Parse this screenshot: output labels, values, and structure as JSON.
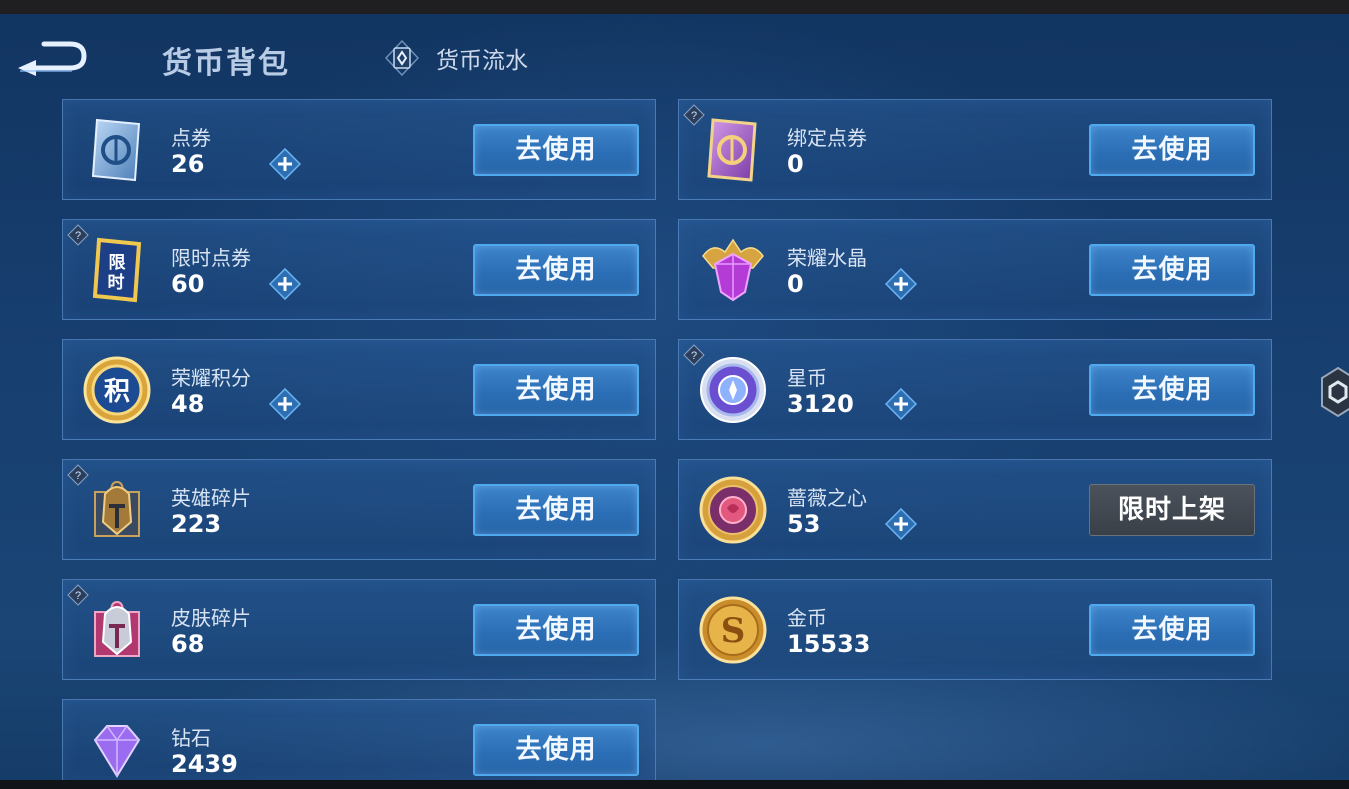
{
  "header": {
    "title": "货币背包",
    "flow_label": "货币流水"
  },
  "currencies": [
    {
      "name": "点券",
      "amount": "26",
      "button": "去使用"
    },
    {
      "name": "绑定点券",
      "amount": "0",
      "button": "去使用"
    },
    {
      "name": "限时点券",
      "amount": "60",
      "button": "去使用",
      "icon_text": "限时"
    },
    {
      "name": "荣耀水晶",
      "amount": "0",
      "button": "去使用"
    },
    {
      "name": "荣耀积分",
      "amount": "48",
      "button": "去使用",
      "icon_text": "积"
    },
    {
      "name": "星币",
      "amount": "3120",
      "button": "去使用"
    },
    {
      "name": "英雄碎片",
      "amount": "223",
      "button": "去使用"
    },
    {
      "name": "蔷薇之心",
      "amount": "53",
      "button": "限时上架"
    },
    {
      "name": "皮肤碎片",
      "amount": "68",
      "button": "去使用"
    },
    {
      "name": "金币",
      "amount": "15533",
      "button": "去使用",
      "icon_text": "S"
    },
    {
      "name": "钻石",
      "amount": "2439",
      "button": "去使用"
    }
  ],
  "icons": {
    "back": "back-arrow-icon",
    "flow": "coin-card-icon",
    "plus": "plus-icon",
    "help": "question-icon",
    "side": "hexagon-handle-icon"
  },
  "colors": {
    "button_blue": "#2c6fb6",
    "button_border": "#4fa9ef",
    "limited_gray": "#3a4048",
    "background": "#173f70"
  }
}
